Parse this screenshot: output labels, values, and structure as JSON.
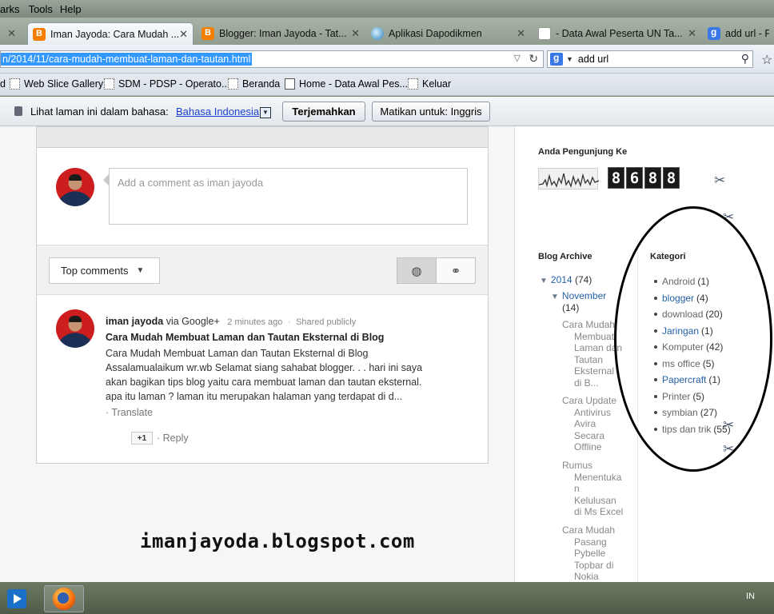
{
  "menu": {
    "items": [
      "arks",
      "Tools",
      "Help"
    ]
  },
  "tabs": [
    {
      "label": "Iman Jayoda: Cara Mudah ...",
      "icon": "blogger-icon",
      "active": true
    },
    {
      "label": "Blogger: Iman Jayoda - Tat...",
      "icon": "blogger-icon"
    },
    {
      "label": "Aplikasi Dapodikmen",
      "icon": "globe-icon"
    },
    {
      "label": "- Data Awal Peserta UN Ta...",
      "icon": "document-icon"
    },
    {
      "label": "add url - Pen",
      "icon": "google-icon"
    }
  ],
  "nav": {
    "url": "n/2014/11/cara-mudah-membuat-laman-dan-tautan.html",
    "search_value": "add url"
  },
  "bookmarks": [
    {
      "label": "d"
    },
    {
      "label": "Web Slice Gallery"
    },
    {
      "label": "SDM - PDSP - Operato..."
    },
    {
      "label": "Beranda"
    },
    {
      "label": "Home - Data Awal Pes..."
    },
    {
      "label": "Keluar"
    }
  ],
  "translate": {
    "prompt": "Lihat laman ini dalam bahasa:",
    "language": "Bahasa Indonesia",
    "translate_button": "Terjemahkan",
    "disable_button": "Matikan untuk: Inggris"
  },
  "comments": {
    "placeholder": "Add a comment as iman jayoda",
    "sort_label": "Top comments",
    "item": {
      "author": "iman jayoda",
      "via": "via Google+",
      "time": "2 minutes ago",
      "visibility": "Shared publicly",
      "title": "Cara Mudah Membuat Laman dan Tautan Eksternal di Blog",
      "body_lines": [
        "Cara Mudah Membuat Laman dan Tautan Eksternal di Blog",
        "Assalamualaikum wr.wb Selamat siang sahabat blogger. . . hari ini saya",
        "akan bagikan tips blog yaitu cara membuat laman dan tautan eksternal.",
        "apa itu laman ? laman itu merupakan halaman yang terdapat di d..."
      ],
      "translate": "· Translate",
      "plus_one": "+1",
      "reply": "· Reply"
    }
  },
  "sidebar": {
    "visitor_heading": "Anda Pengunjung Ke",
    "visitor_digits": [
      "8",
      "6",
      "8",
      "8"
    ],
    "archive_heading": "Blog Archive",
    "archive": {
      "year": "2014",
      "year_count": "(74)",
      "month": "November",
      "month_count": "(14)",
      "posts": [
        [
          "Cara Mudah",
          "Membuat",
          "Laman dan",
          "Tautan",
          "Eksternal",
          "di B..."
        ],
        [
          "Cara Update",
          "Antivirus",
          "Avira",
          "Secara",
          "Offline"
        ],
        [
          "Rumus",
          "Menentuka",
          "n",
          "Kelulusan",
          "di Ms Excel"
        ],
        [
          "Cara Mudah",
          "Pasang",
          "Pybelle",
          "Topbar di",
          "Nokia"
        ]
      ]
    },
    "kategori_heading": "Kategori",
    "kategori": [
      {
        "name": "Android",
        "count": "(1)",
        "link": false
      },
      {
        "name": "blogger",
        "count": "(4)",
        "link": true
      },
      {
        "name": "download",
        "count": "(20)",
        "link": false
      },
      {
        "name": "Jaringan",
        "count": "(1)",
        "link": true
      },
      {
        "name": "Komputer",
        "count": "(42)",
        "link": false
      },
      {
        "name": "ms office",
        "count": "(5)",
        "link": false
      },
      {
        "name": "Papercraft",
        "count": "(1)",
        "link": true
      },
      {
        "name": "Printer",
        "count": "(5)",
        "link": false
      },
      {
        "name": "symbian",
        "count": "(27)",
        "link": false
      },
      {
        "name": "tips dan trik",
        "count": "(55)",
        "link": false
      }
    ]
  },
  "watermark": "imanjayoda.blogspot.com",
  "taskbar": {
    "lang": "IN"
  }
}
